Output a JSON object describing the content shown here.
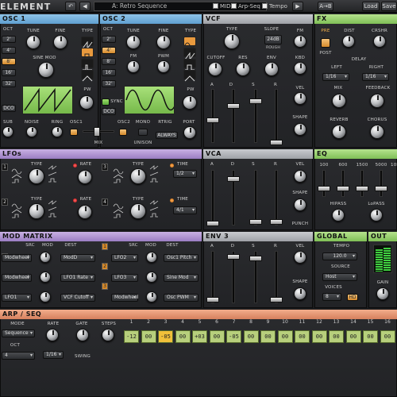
{
  "topbar": {
    "logo": "ELEMENT",
    "preset_name": "A: Retro Sequence",
    "midi_label": "MIDI",
    "arpseq_label": "Arp-Seq",
    "tempo_label": "Tempo",
    "ab_label": "A→B",
    "load_label": "Load",
    "save_label": "Save"
  },
  "osc1": {
    "title": "OSC 1",
    "oct_label": "OCT",
    "oct_values": [
      "2'",
      "4'",
      "8'",
      "16'",
      "32'"
    ],
    "oct_selected": "8'",
    "tune_label": "TUNE",
    "fine_label": "FINE",
    "type_label": "TYPE",
    "sine_mod_label": "SINE MOD",
    "pw_label": "PW",
    "dco_label": "DCO"
  },
  "osc2": {
    "title": "OSC 2",
    "oct_label": "OCT",
    "oct_values": [
      "2'",
      "4'",
      "8'",
      "16'",
      "32'"
    ],
    "oct_selected": "4'",
    "tune_label": "TUNE",
    "fine_label": "FINE",
    "type_label": "TYPE",
    "fm_label": "FM",
    "pwm_label": "PWM",
    "pw_label": "PW",
    "sync_label": "SYNC",
    "dco_label": "DCO"
  },
  "mixer": {
    "sub": "SUB",
    "noise": "NOISE",
    "ring": "RING",
    "osc1": "OSC1",
    "osc2": "OSC2",
    "mono": "MONO",
    "rtrig": "RTRIG",
    "port": "PORT",
    "mix": "MIX",
    "unison": "UNISON",
    "always": "ALWAYS"
  },
  "vcf": {
    "title": "VCF",
    "type_label": "TYPE",
    "slope_label": "SLOPE",
    "slope_value": "24dB",
    "slope_sub": "ROUGH",
    "fm_label": "FM",
    "cutoff_label": "CUTOFF",
    "res_label": "RES",
    "env_label": "ENV",
    "kbd_label": "KBD",
    "vel_label": "VEL",
    "shape_label": "SHAPE",
    "adsr": [
      "A",
      "D",
      "S",
      "R"
    ]
  },
  "fx": {
    "title": "FX",
    "pre": "PRE",
    "dist": "DIST",
    "crshr": "CRSHR",
    "post": "POST",
    "delay": "DELAY",
    "left": "LEFT",
    "right": "RIGHT",
    "left_value": "1/16",
    "right_value": "1/16",
    "mix": "MIX",
    "feedback": "FEEDBACK",
    "reverb": "REVERB",
    "chorus": "CHORUS"
  },
  "lfos": {
    "title": "LFOs",
    "type_label": "TYPE",
    "rate_label": "RATE",
    "time_label": "TIME",
    "time_values": [
      "1/2",
      "4/1"
    ],
    "slots": [
      "1",
      "2",
      "3",
      "4"
    ]
  },
  "vca": {
    "title": "VCA",
    "adsr": [
      "A",
      "D",
      "S",
      "R"
    ],
    "vel_label": "VEL",
    "shape_label": "SHAPE",
    "punch_label": "PUNCH"
  },
  "eq": {
    "title": "EQ",
    "bands": [
      "100",
      "600",
      "1500",
      "5000",
      "10k"
    ],
    "hipass": "HIPASS",
    "lopass": "LoPASS"
  },
  "modmatrix": {
    "title": "MOD MATRIX",
    "src_label": "SRC",
    "mod_label": "MOD",
    "dest_label": "DEST",
    "left": [
      {
        "n": "1",
        "src": "Modwheel",
        "dest": "ModD"
      },
      {
        "n": "2",
        "src": "Modwheel",
        "dest": "LFO1 Rate"
      },
      {
        "n": "3",
        "src": "LFO1",
        "dest": "VCF Cutoff"
      }
    ],
    "right": [
      {
        "n": "1",
        "src": "LFO2",
        "dest": "Osc1 Pitch"
      },
      {
        "n": "2",
        "src": "LFO3",
        "dest": "Sine Mod"
      },
      {
        "n": "3",
        "src": "Modwheel",
        "dest": "Osc PWM"
      }
    ]
  },
  "env3": {
    "title": "ENV 3",
    "adsr": [
      "A",
      "D",
      "S",
      "R"
    ],
    "vel_label": "VEL",
    "shape_label": "SHAPE"
  },
  "global": {
    "title": "GLOBAL",
    "tempo_label": "TEMPO",
    "tempo_value": "120.0",
    "source_label": "SOURCE",
    "source_value": "Host",
    "voices_label": "VOICES",
    "voices_value": "8",
    "hd_label": "HD"
  },
  "out": {
    "title": "OUT",
    "gain_label": "GAIN"
  },
  "arpseq": {
    "title": "ARP / SEQ",
    "mode_label": "MODE",
    "mode_value": "Sequence",
    "rate_label": "RATE",
    "rate_value": "1/16",
    "oct_label": "OCT",
    "oct_value": "4",
    "gate_label": "GATE",
    "steps_label": "STEPS",
    "swing_label": "SWING",
    "step_numbers": [
      "1",
      "2",
      "3",
      "4",
      "5",
      "6",
      "7",
      "8",
      "9",
      "10",
      "11",
      "12",
      "13",
      "14",
      "15",
      "16"
    ],
    "step_values": [
      "-12",
      "00",
      "-05",
      "00",
      "+03",
      "00",
      "-05",
      "00",
      "00",
      "00",
      "00",
      "00",
      "00",
      "00",
      "00",
      "00"
    ],
    "active_step": "3"
  }
}
